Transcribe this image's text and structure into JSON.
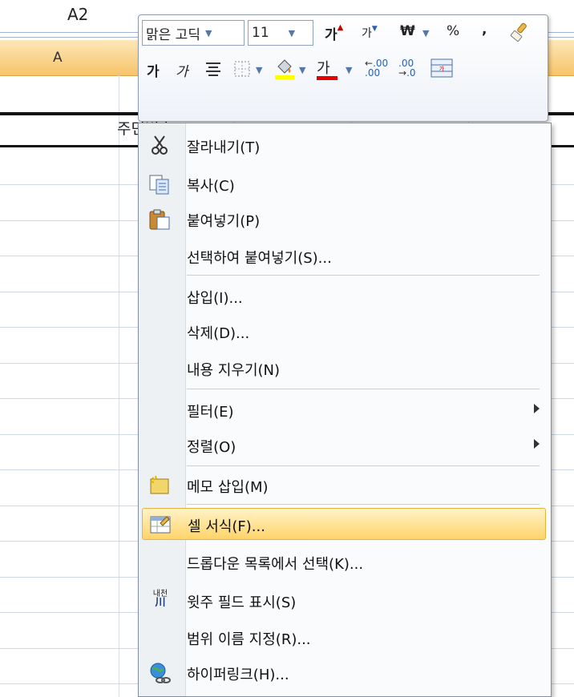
{
  "name_box": "A2",
  "column_header": "A",
  "cell_text": "주민번호",
  "mini_toolbar": {
    "font_name": "맑은 고딕",
    "font_size": "11",
    "grow_font": "가",
    "shrink_font": "가",
    "currency": "₩",
    "percent": "%",
    "comma": ",",
    "bold": "가",
    "italic": "가",
    "font_color": "가",
    "increase_decimal": ".00",
    "decrease_decimal": ".00"
  },
  "context_menu": {
    "items": [
      {
        "label": "잘라내기(T)",
        "icon": "scissors-icon"
      },
      {
        "label": "복사(C)",
        "icon": "copy-icon"
      },
      {
        "label": "붙여넣기(P)",
        "icon": "paste-icon"
      },
      {
        "label": "선택하여 붙여넣기(S)...",
        "icon": ""
      },
      {
        "label": "삽입(I)...",
        "icon": ""
      },
      {
        "label": "삭제(D)...",
        "icon": ""
      },
      {
        "label": "내용 지우기(N)",
        "icon": ""
      },
      {
        "label": "필터(E)",
        "icon": ""
      },
      {
        "label": "정렬(O)",
        "icon": ""
      },
      {
        "label": "메모 삽입(M)",
        "icon": "comment-icon"
      },
      {
        "label": "셀 서식(F)...",
        "icon": "format-cells-icon"
      },
      {
        "label": "드롭다운 목록에서 선택(K)...",
        "icon": ""
      },
      {
        "label": "윗주 필드 표시(S)",
        "icon": "phonetic-icon"
      },
      {
        "label": "범위 이름 지정(R)...",
        "icon": ""
      },
      {
        "label": "하이퍼링크(H)...",
        "icon": "hyperlink-icon"
      }
    ],
    "phonetic_icon_text": "내천",
    "phonetic_icon_sub": "川"
  }
}
